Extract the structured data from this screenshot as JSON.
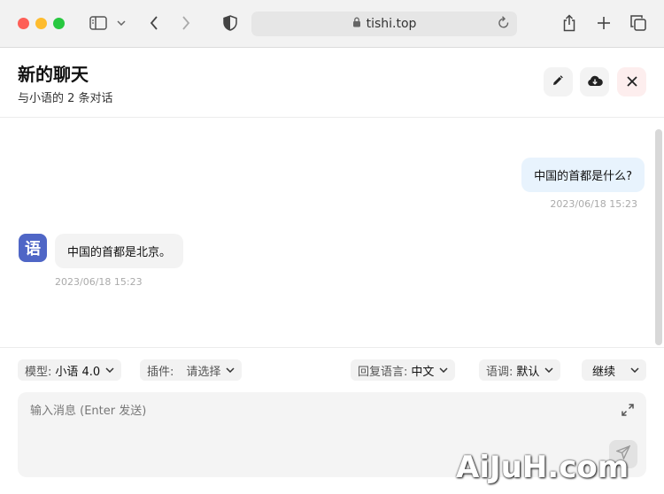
{
  "browser": {
    "url": "tishi.top"
  },
  "header": {
    "title": "新的聊天",
    "subtitle": "与小语的 2 条对话"
  },
  "messages": [
    {
      "role": "user",
      "text": "中国的首都是什么?",
      "time": "2023/06/18 15:23"
    },
    {
      "role": "assistant",
      "text": "中国的首都是北京。",
      "time": "2023/06/18 15:23",
      "avatar_text": "语"
    }
  ],
  "composer": {
    "model_label": "模型:",
    "model_value": "小语 4.0",
    "plugin_label": "插件:",
    "plugin_value": "请选择",
    "reply_lang_label": "回复语言:",
    "reply_lang_value": "中文",
    "tone_label": "语调:",
    "tone_value": "默认",
    "continue_label": "继续",
    "input_placeholder": "输入消息 (Enter 发送)"
  },
  "watermark": "AiJuH.com",
  "colors": {
    "user_bubble": "#e8f3fd",
    "bot_bubble": "#f3f3f3",
    "avatar_bg": "#4f66c6",
    "close_btn_bg": "#fdeeee"
  }
}
